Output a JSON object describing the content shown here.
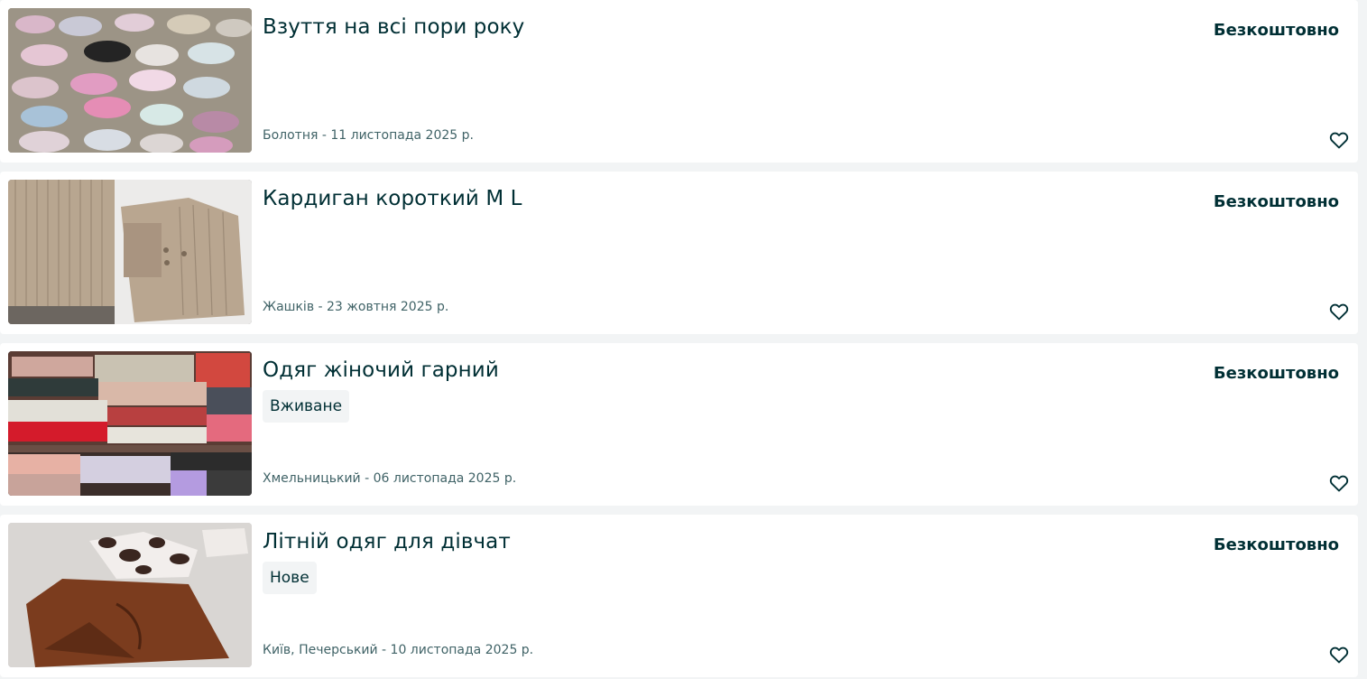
{
  "listings": [
    {
      "title": "Взуття на всі пори року",
      "condition": "",
      "meta": "Болотня - 11 листопада 2025 р.",
      "price": "Безкоштовно",
      "image": "kids-shoes-photo",
      "favorite_icon": "heart-outline-icon"
    },
    {
      "title": "Кардиган короткий M L",
      "condition": "",
      "meta": "Жашків - 23 жовтня 2025 р.",
      "price": "Безкоштовно",
      "image": "cardigan-photo",
      "favorite_icon": "heart-outline-icon"
    },
    {
      "title": "Одяг жіночий гарний",
      "condition": "Вживане",
      "meta": "Хмельницький - 06 листопада 2025 р.",
      "price": "Безкоштовно",
      "image": "folded-clothes-photo",
      "favorite_icon": "heart-outline-icon"
    },
    {
      "title": "Літній одяг для дівчат",
      "condition": "Нове",
      "meta": "Київ, Печерський - 10 листопада 2025 р.",
      "price": "Безкоштовно",
      "image": "summer-clothes-photo",
      "favorite_icon": "heart-outline-icon"
    }
  ],
  "colors": {
    "text": "#002f34",
    "meta_text": "#406367",
    "badge_bg": "#f2f4f5",
    "page_bg": "#f2f4f5",
    "card_bg": "#ffffff"
  }
}
